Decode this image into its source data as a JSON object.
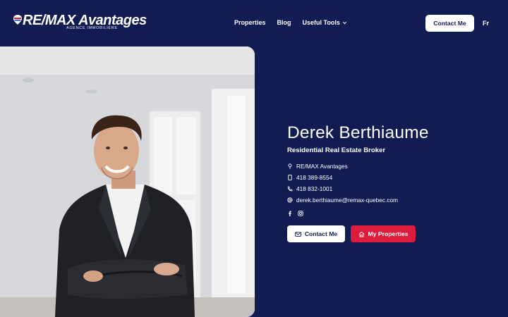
{
  "brand": {
    "logo_main": "RE/MAX Avantages",
    "logo_sub": "AGENCE IMMOBILIÈRE",
    "colors": {
      "navy": "#111d52",
      "red": "#dc1c3a",
      "white": "#ffffff"
    }
  },
  "nav": {
    "items": [
      "Properties",
      "Blog",
      "Useful Tools"
    ],
    "contact_button": "Contact Me",
    "language": "Fr"
  },
  "profile": {
    "name": "Derek Berthiaume",
    "title": "Residential Real Estate Broker",
    "agency": "RE/MAX Avantages",
    "phone_mobile": "418 389-8554",
    "phone_office": "418 832-1001",
    "email": "derek.berthiaume@remax-quebec.com",
    "icons": [
      "location-pin-icon",
      "mobile-phone-icon",
      "phone-icon",
      "at-icon"
    ],
    "social": [
      "facebook-icon",
      "instagram-icon"
    ]
  },
  "actions": {
    "contact_label": "Contact Me",
    "properties_label": "My Properties"
  }
}
